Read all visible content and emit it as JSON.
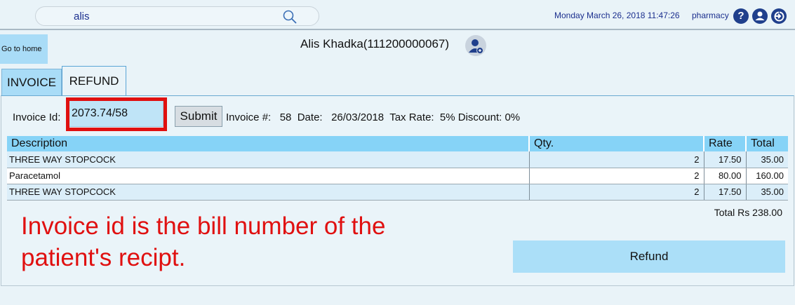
{
  "search": {
    "value": "alis"
  },
  "header": {
    "datetime": "Monday March 26, 2018 11:47:26",
    "role": "pharmacy"
  },
  "nav": {
    "home_label": "Go to home"
  },
  "patient": {
    "name": "Alis  Khadka(111200000067)"
  },
  "tabs": [
    {
      "label": "INVOICE"
    },
    {
      "label": "REFUND"
    }
  ],
  "invoice_form": {
    "id_label": "Invoice Id:",
    "id_value": "2073.74/58",
    "submit_label": "Submit",
    "summary": "Invoice #:   58  Date:   26/03/2018  Tax Rate:  5% Discount: 0%"
  },
  "table": {
    "headers": [
      "Description",
      "Qty.",
      "Rate",
      "Total"
    ],
    "rows": [
      {
        "description": "THREE WAY STOPCOCK",
        "qty": "2",
        "rate": "17.50",
        "total": "35.00"
      },
      {
        "description": "Paracetamol",
        "qty": "2",
        "rate": "80.00",
        "total": "160.00"
      },
      {
        "description": "THREE WAY STOPCOCK",
        "qty": "2",
        "rate": "17.50",
        "total": "35.00"
      }
    ]
  },
  "total_text": "Total Rs 238.00",
  "annotation": "Invoice id is the bill number of the patient's recipt.",
  "refund_label": "Refund",
  "colors": {
    "accent": "#86d3f7",
    "highlight": "#e01010",
    "brand": "#1f3f8c"
  },
  "icons": [
    "search-icon",
    "help-icon",
    "user-icon",
    "logout-icon",
    "patient-avatar-icon"
  ]
}
